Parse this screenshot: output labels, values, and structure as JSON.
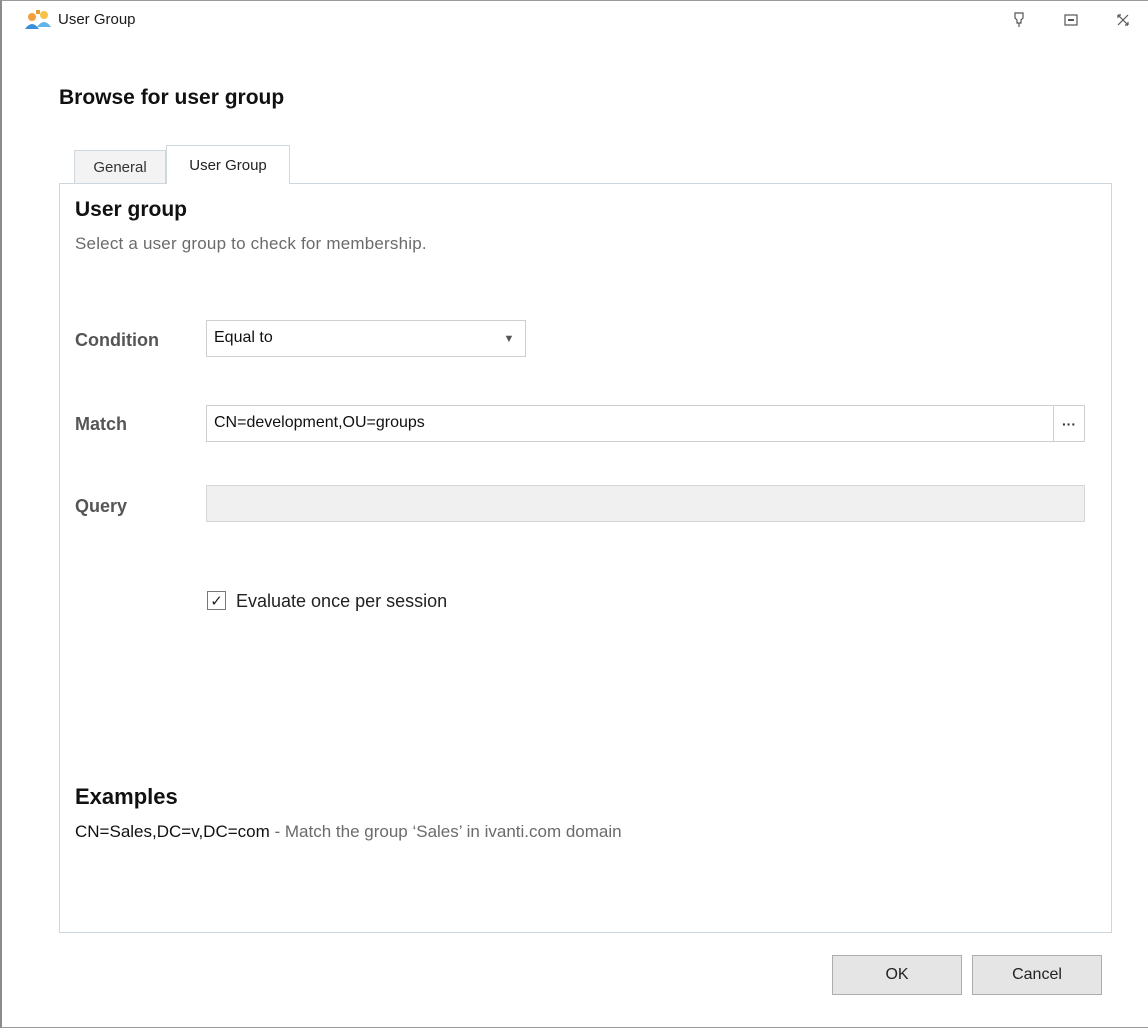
{
  "window": {
    "title": "User Group"
  },
  "dialog": {
    "heading": "Browse for user group"
  },
  "tabs": [
    {
      "label": "General",
      "active": false
    },
    {
      "label": "User Group",
      "active": true
    }
  ],
  "section": {
    "title": "User group",
    "subtitle": "Select a user group to check for membership."
  },
  "form": {
    "condition_label": "Condition",
    "condition_value": "Equal to",
    "match_label": "Match",
    "match_value": "CN=development,OU=groups",
    "browse_label": "···",
    "query_label": "Query",
    "query_value": "",
    "evaluate_checked": true,
    "evaluate_label": "Evaluate once per session"
  },
  "examples": {
    "title": "Examples",
    "code": "CN=Sales,DC=v,DC=com",
    "description": " - Match the group ‘Sales’ in ivanti.com domain"
  },
  "buttons": {
    "ok": "OK",
    "cancel": "Cancel"
  },
  "colors": {
    "panel_border": "#cdd7dd",
    "label_gray": "#555555",
    "hint_gray": "#6b6b6b",
    "button_bg": "#e5e5e5"
  },
  "icons": {
    "app": "user-group-icon",
    "titlebar": [
      "pin-icon",
      "restore-icon",
      "close-icon"
    ]
  }
}
